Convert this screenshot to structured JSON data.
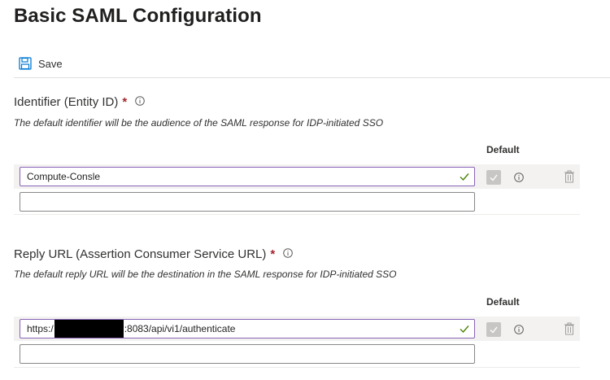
{
  "page": {
    "title": "Basic SAML Configuration"
  },
  "toolbar": {
    "save_label": "Save",
    "save_icon": "floppy-disk-icon"
  },
  "identifier": {
    "label": "Identifier (Entity ID)",
    "required_mark": "*",
    "description": "The default identifier will be the audience of the SAML response for IDP-initiated SSO",
    "default_header": "Default",
    "rows": [
      {
        "value": "Compute-Consle",
        "default_checked": true
      },
      {
        "value": ""
      }
    ]
  },
  "reply_url": {
    "label": "Reply URL (Assertion Consumer Service URL)",
    "required_mark": "*",
    "description": "The default reply URL will be the destination in the SAML response for IDP-initiated SSO",
    "default_header": "Default",
    "rows": [
      {
        "value_prefix": "https:/",
        "value_suffix": ":8083/api/vi1/authenticate",
        "redacted": true,
        "default_checked": true
      },
      {
        "value": ""
      }
    ]
  },
  "colors": {
    "accent": "#8764b8",
    "valid_check": "#498205",
    "required": "#a4262c",
    "save_icon": "#0078d4"
  }
}
